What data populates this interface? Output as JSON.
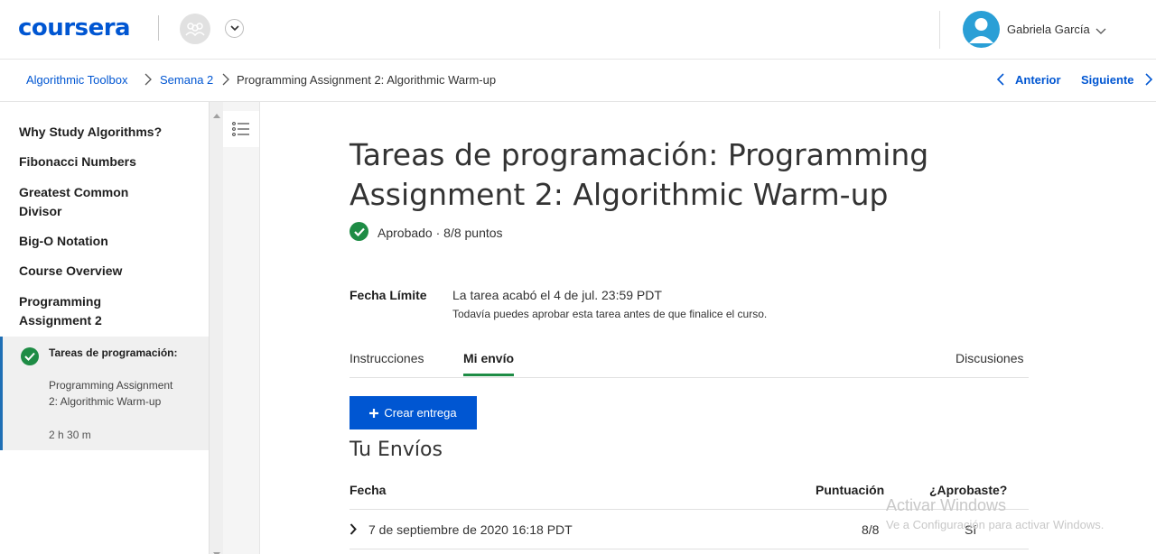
{
  "header": {
    "logo": "coursera",
    "user_name": "Gabriela García"
  },
  "breadcrumb": {
    "items": [
      "Algorithmic Toolbox",
      "Semana 2",
      "Programming Assignment 2: Algorithmic Warm-up"
    ],
    "prev_label": "Anterior",
    "next_label": "Siguiente"
  },
  "sidebar": {
    "items": [
      "Why Study Algorithms?",
      "Fibonacci Numbers",
      "Greatest Common Divisor",
      "Big-O Notation",
      "Course Overview",
      "Programming Assignment 2"
    ],
    "active": {
      "title": "Tareas de programación:",
      "text": "Programming Assignment 2: Algorithmic Warm-up",
      "duration": "2 h 30 m"
    }
  },
  "main": {
    "title": "Tareas de programación: Programming Assignment 2: Algorithmic Warm-up",
    "status": "Aprobado · 8/8 puntos",
    "due_label": "Fecha Límite",
    "due_value": "La tarea acabó el 4 de jul. 23:59 PDT",
    "due_note": "Todavía puedes aprobar esta tarea antes de que finalice el curso.",
    "tabs": [
      "Instrucciones",
      "Mi envío",
      "Discusiones"
    ],
    "create_button": "Crear entrega",
    "submissions_title": "Tu Envíos",
    "table": {
      "headers": [
        "Fecha",
        "Puntuación",
        "¿Aprobaste?"
      ],
      "rows": [
        {
          "date": "7 de septiembre de 2020 16:18 PDT",
          "score": "8/8",
          "passed": "Sí"
        }
      ]
    }
  },
  "watermark": {
    "line1": "Activar Windows",
    "line2": "Ve a Configuración para activar Windows."
  },
  "colors": {
    "brand": "#0056d2",
    "success": "#1e8c45"
  }
}
